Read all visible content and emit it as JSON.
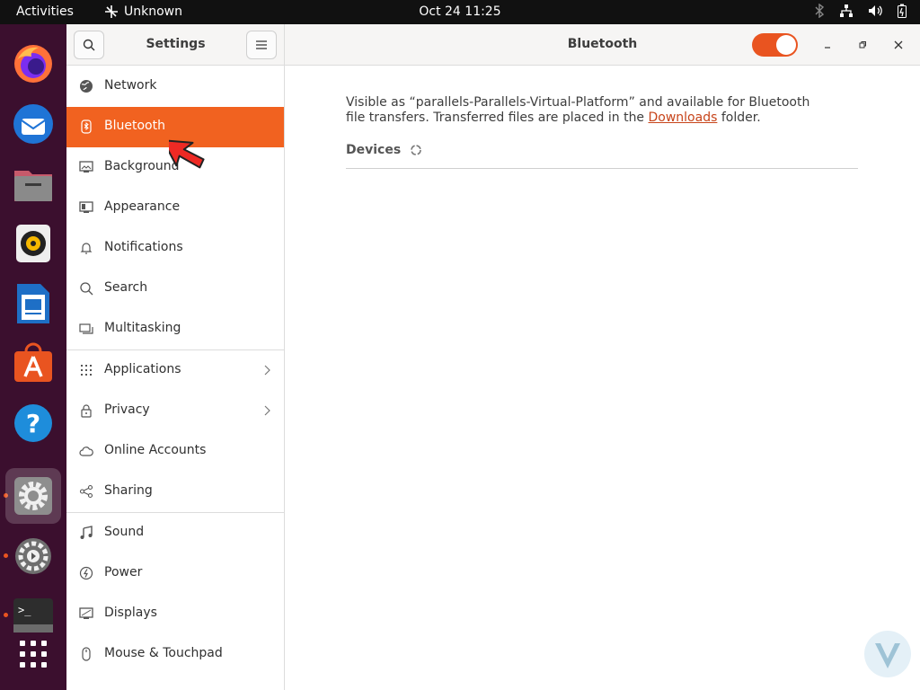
{
  "topbar": {
    "activities": "Activities",
    "app_name": "Unknown",
    "clock": "Oct 24  11:25"
  },
  "dock": {
    "apps": [
      "firefox-icon",
      "thunderbird-icon",
      "files-icon",
      "rhythmbox-icon",
      "writer-icon",
      "software-icon",
      "help-icon",
      "settings-icon",
      "settings-alt-icon",
      "terminal-icon",
      "app-grid-icon"
    ]
  },
  "sidebar": {
    "title": "Settings",
    "items": [
      {
        "label": "Network",
        "icon": "network-icon"
      },
      {
        "label": "Bluetooth",
        "icon": "bluetooth-icon"
      },
      {
        "label": "Background",
        "icon": "background-icon"
      },
      {
        "label": "Appearance",
        "icon": "appearance-icon"
      },
      {
        "label": "Notifications",
        "icon": "bell-icon"
      },
      {
        "label": "Search",
        "icon": "search-icon"
      },
      {
        "label": "Multitasking",
        "icon": "multitasking-icon"
      },
      {
        "label": "Applications",
        "icon": "grid-icon"
      },
      {
        "label": "Privacy",
        "icon": "lock-icon"
      },
      {
        "label": "Online Accounts",
        "icon": "cloud-icon"
      },
      {
        "label": "Sharing",
        "icon": "share-icon"
      },
      {
        "label": "Sound",
        "icon": "music-note-icon"
      },
      {
        "label": "Power",
        "icon": "power-icon"
      },
      {
        "label": "Displays",
        "icon": "display-icon"
      },
      {
        "label": "Mouse & Touchpad",
        "icon": "mouse-icon"
      }
    ]
  },
  "content": {
    "title": "Bluetooth",
    "bluetooth_enabled": true,
    "description_before": "Visible as “parallels-Parallels-Virtual-Platform” and available for Bluetooth file transfers. Transferred files are placed in the ",
    "description_link": "Downloads",
    "description_after": " folder.",
    "devices_heading": "Devices"
  },
  "colors": {
    "accent": "#e95420",
    "selected_row": "#f16220",
    "dock_bg": "#3b0f2e",
    "topbar_bg": "#111111"
  }
}
